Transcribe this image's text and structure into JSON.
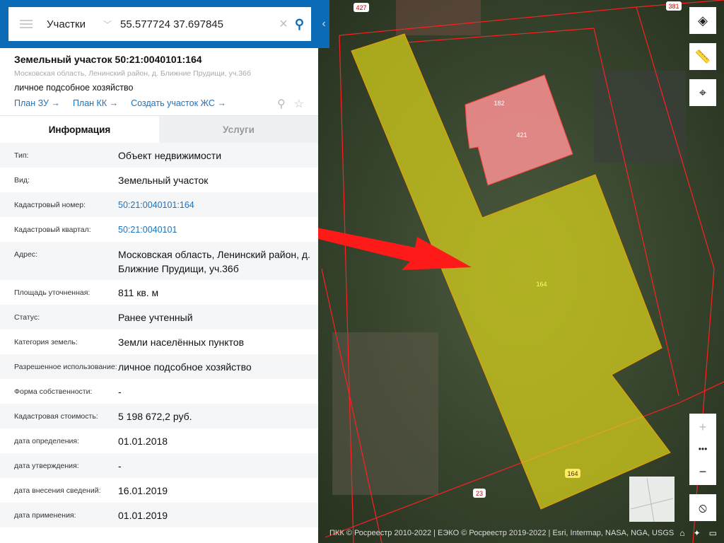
{
  "search": {
    "category": "Участки",
    "query": "55.577724 37.697845"
  },
  "object": {
    "title": "Земельный участок 50:21:0040101:164",
    "address": "Московская область, Ленинский район, д. Ближние Прудищи, уч.36б",
    "use": "личное подсобное хозяйство",
    "links": [
      "План ЗУ →",
      "План КК →",
      "Создать участок ЖС →"
    ]
  },
  "tabs": [
    "Информация",
    "Услуги"
  ],
  "rows": [
    {
      "label": "Тип:",
      "value": "Объект недвижимости"
    },
    {
      "label": "Вид:",
      "value": "Земельный участок"
    },
    {
      "label": "Кадастровый номер:",
      "value": "50:21:0040101:164",
      "link": true
    },
    {
      "label": "Кадастровый квартал:",
      "value": "50:21:0040101",
      "link": true
    },
    {
      "label": "Адрес:",
      "value": "Московская область, Ленинский район, д. Ближние Прудищи, уч.36б"
    },
    {
      "label": "Площадь уточненная:",
      "value": "811 кв. м"
    },
    {
      "label": "Статус:",
      "value": "Ранее учтенный"
    },
    {
      "label": "Категория земель:",
      "value": "Земли населённых пунктов"
    },
    {
      "label": "Разрешенное использование:",
      "value": "личное подсобное хозяйство"
    },
    {
      "label": "Форма собственности:",
      "value": "-"
    },
    {
      "label": "Кадастровая стоимость:",
      "value": "5 198 672,2 руб."
    },
    {
      "label": "дата определения:",
      "value": "01.01.2018"
    },
    {
      "label": "дата утверждения:",
      "value": "-"
    },
    {
      "label": "дата внесения сведений:",
      "value": "16.01.2019"
    },
    {
      "label": "дата применения:",
      "value": "01.01.2019"
    }
  ],
  "map": {
    "labels": {
      "l427": "427",
      "l381": "381",
      "l182": "182",
      "l421": "421",
      "l164a": "164",
      "l164b": "164",
      "l23": "23"
    },
    "attribution": "ПКК © Росреестр 2010-2022 | ЕЭКО © Росреестр 2019-2022 | Esri, Intermap, NASA, NGA, USGS",
    "colors": {
      "parcel": "#d9d21a",
      "building": "#e88a8a",
      "border": "#ff2020",
      "arrow": "#ff1a1a"
    }
  }
}
